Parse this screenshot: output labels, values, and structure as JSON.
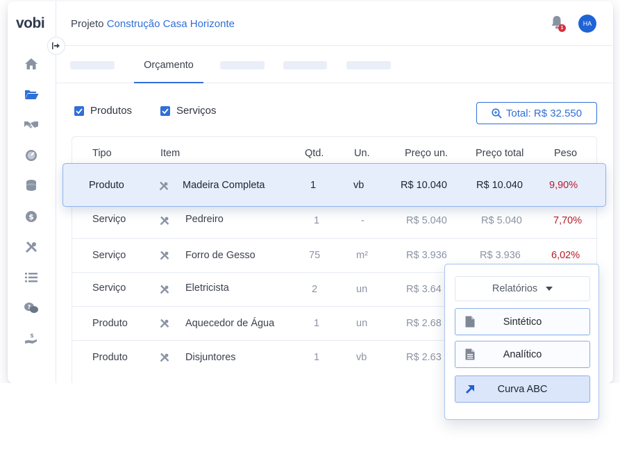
{
  "brand": {
    "logo_text": "vobi"
  },
  "header": {
    "project_prefix": "Projeto",
    "project_name": "Construção Casa Horizonte",
    "notification_count": "1",
    "avatar_initials": "HA"
  },
  "tabs": {
    "active_label": "Orçamento"
  },
  "filters": {
    "produtos_label": "Produtos",
    "servicos_label": "Serviços",
    "produtos_checked": true,
    "servicos_checked": true
  },
  "total_button": {
    "label": "Total: R$ 32.550"
  },
  "table": {
    "columns": [
      "Tipo",
      "Item",
      "Qtd.",
      "Un.",
      "Preço un.",
      "Preço total",
      "Peso"
    ],
    "highlighted_row": {
      "tipo": "Produto",
      "item": "Madeira Completa",
      "qtd": "1",
      "un": "vb",
      "preco_un": "R$ 10.040",
      "preco_total": "R$ 10.040",
      "peso": "9,90%"
    },
    "rows": [
      {
        "tipo": "Serviço",
        "item": "Pedreiro",
        "qtd": "1",
        "un": "-",
        "preco_un": "R$ 5.040",
        "preco_total": "R$ 5.040",
        "peso": "7,70%"
      },
      {
        "tipo": "Serviço",
        "item": "Forro de Gesso",
        "qtd": "75",
        "un": "m²",
        "preco_un": "R$ 3.936",
        "preco_total": "R$ 3.936",
        "peso": "6,02%"
      },
      {
        "tipo": "Serviço",
        "item": "Eletricista",
        "qtd": "2",
        "un": "un",
        "preco_un": "R$ 3.64",
        "preco_total": "",
        "peso": ""
      },
      {
        "tipo": "Produto",
        "item": "Aquecedor de Água",
        "qtd": "1",
        "un": "un",
        "preco_un": "R$ 2.68",
        "preco_total": "",
        "peso": ""
      },
      {
        "tipo": "Produto",
        "item": "Disjuntores",
        "qtd": "1",
        "un": "vb",
        "preco_un": "R$ 2.63",
        "preco_total": "",
        "peso": ""
      }
    ]
  },
  "reports": {
    "select_label": "Relatórios",
    "items": [
      {
        "label": "Sintético",
        "icon": "document-icon"
      },
      {
        "label": "Analítico",
        "icon": "document-lines-icon"
      },
      {
        "label": "Curva ABC",
        "icon": "arrow-up-right-icon"
      }
    ]
  },
  "colors": {
    "primary": "#2f6fd6",
    "peso_red": "#b81c28",
    "highlight_bg": "#e6eefc",
    "badge_red": "#d6303c"
  }
}
